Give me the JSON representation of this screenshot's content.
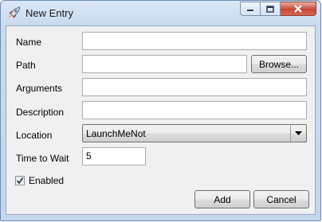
{
  "window": {
    "title": "New Entry",
    "controls": {
      "minimize": "minimize-icon",
      "maximize": "maximize-icon",
      "close": "close-icon"
    }
  },
  "form": {
    "name": {
      "label": "Name",
      "value": ""
    },
    "path": {
      "label": "Path",
      "value": "",
      "browse_label": "Browse..."
    },
    "arguments": {
      "label": "Arguments",
      "value": ""
    },
    "description": {
      "label": "Description",
      "value": ""
    },
    "location": {
      "label": "Location",
      "value": "LaunchMeNot"
    },
    "time_to_wait": {
      "label": "Time to Wait",
      "value": "5"
    },
    "enabled": {
      "label": "Enabled",
      "checked": true
    }
  },
  "buttons": {
    "add": "Add",
    "cancel": "Cancel"
  },
  "icons": {
    "app": "rocket-icon",
    "dropdown": "chevron-down-icon",
    "check": "check-icon"
  }
}
